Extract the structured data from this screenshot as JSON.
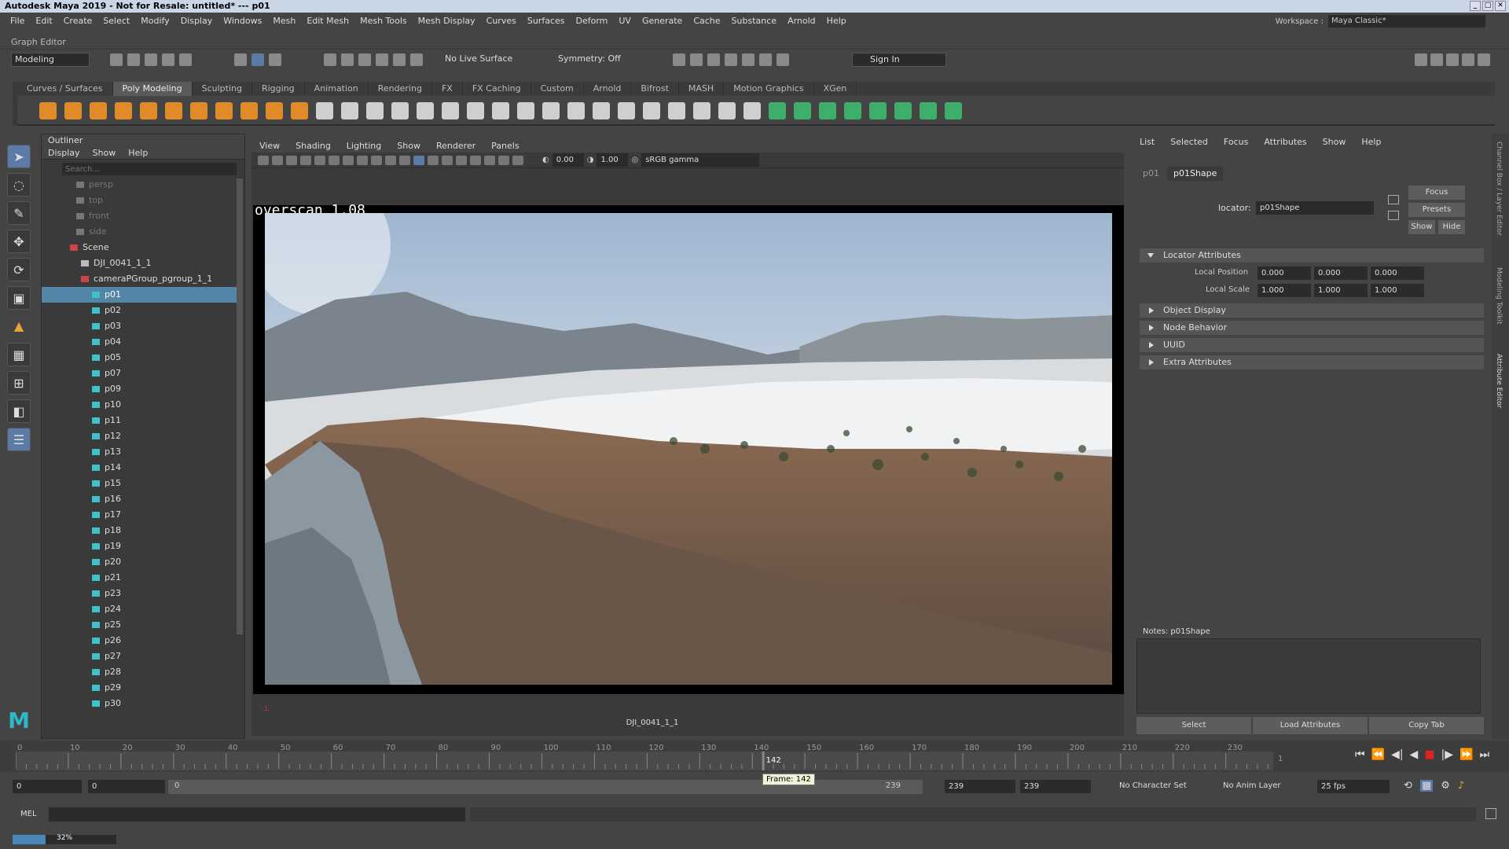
{
  "title": "Autodesk Maya 2019 - Not for Resale: untitled*   ---   p01",
  "menus": [
    "File",
    "Edit",
    "Create",
    "Select",
    "Modify",
    "Display",
    "Windows",
    "Mesh",
    "Edit Mesh",
    "Mesh Tools",
    "Mesh Display",
    "Curves",
    "Surfaces",
    "Deform",
    "UV",
    "Generate",
    "Cache",
    "Substance",
    "Arnold",
    "Help"
  ],
  "workspace": {
    "label": "Workspace :",
    "value": "Maya Classic*"
  },
  "graph_editor": "Graph Editor",
  "status_line": {
    "mode": "Modeling",
    "live_surface": "No Live Surface",
    "symmetry": "Symmetry: Off",
    "sign_in": "Sign In"
  },
  "shelf_tabs": [
    "Curves / Surfaces",
    "Poly Modeling",
    "Sculpting",
    "Rigging",
    "Animation",
    "Rendering",
    "FX",
    "FX Caching",
    "Custom",
    "Arnold",
    "Bifrost",
    "MASH",
    "Motion Graphics",
    "XGen"
  ],
  "active_shelf": "Poly Modeling",
  "outliner": {
    "title": "Outliner",
    "menu": [
      "Display",
      "Show",
      "Help"
    ],
    "search_placeholder": "Search...",
    "cameras": [
      "persp",
      "top",
      "front",
      "side"
    ],
    "scene": "Scene",
    "image_plane": "DJI_0041_1_1",
    "group": "cameraPGroup_pgroup_1_1",
    "items": [
      "p01",
      "p02",
      "p03",
      "p04",
      "p05",
      "p07",
      "p09",
      "p10",
      "p11",
      "p12",
      "p13",
      "p14",
      "p15",
      "p16",
      "p17",
      "p18",
      "p19",
      "p20",
      "p21",
      "p23",
      "p24",
      "p25",
      "p26",
      "p27",
      "p28",
      "p29",
      "p30"
    ]
  },
  "viewport": {
    "menu": [
      "View",
      "Shading",
      "Lighting",
      "Show",
      "Renderer",
      "Panels"
    ],
    "exposure": "0.00",
    "gamma": "1.00",
    "color_space": "sRGB gamma",
    "overlay_text": "overscan 1.08",
    "camera_label": "DJI_0041_1_1"
  },
  "attribute_editor": {
    "menu": [
      "List",
      "Selected",
      "Focus",
      "Attributes",
      "Show",
      "Help"
    ],
    "tabs": [
      "p01",
      "p01Shape"
    ],
    "locator_label": "locator:",
    "locator_value": "p01Shape",
    "buttons": [
      "Focus",
      "Presets",
      "Show",
      "Hide"
    ],
    "section_open": "Locator Attributes",
    "local_position_label": "Local Position",
    "local_position": [
      "0.000",
      "0.000",
      "0.000"
    ],
    "local_scale_label": "Local Scale",
    "local_scale": [
      "1.000",
      "1.000",
      "1.000"
    ],
    "sections": [
      "Object Display",
      "Node Behavior",
      "UUID",
      "Extra Attributes"
    ],
    "notes": "Notes:  p01Shape",
    "bottom_buttons": [
      "Select",
      "Load Attributes",
      "Copy Tab"
    ]
  },
  "side_tabs": [
    "Channel Box / Layer Editor",
    "Modeling Toolkit",
    "Attribute Editor"
  ],
  "timeline": {
    "ticks": [
      "0",
      "10",
      "20",
      "30",
      "40",
      "50",
      "60",
      "70",
      "80",
      "90",
      "100",
      "110",
      "120",
      "130",
      "140",
      "150",
      "160",
      "170",
      "180",
      "190",
      "200",
      "210",
      "220",
      "230"
    ],
    "current_frame": 142,
    "current_label": "142",
    "end_label": "1",
    "max_frame": 239
  },
  "range_slider": {
    "start": "0",
    "anim_start": "0",
    "range_start": "0",
    "range_end": "239",
    "anim_end": "239",
    "end": "239",
    "tooltip": "Frame: 142",
    "character_set": "No Character Set",
    "anim_layer": "No Anim Layer",
    "fps": "25 fps"
  },
  "command_line": {
    "label": "MEL"
  },
  "progress": {
    "value": 32,
    "label": "32%"
  },
  "colors": {
    "selection": "#5285a6",
    "playhead": "#d22",
    "bg": "#444444"
  }
}
